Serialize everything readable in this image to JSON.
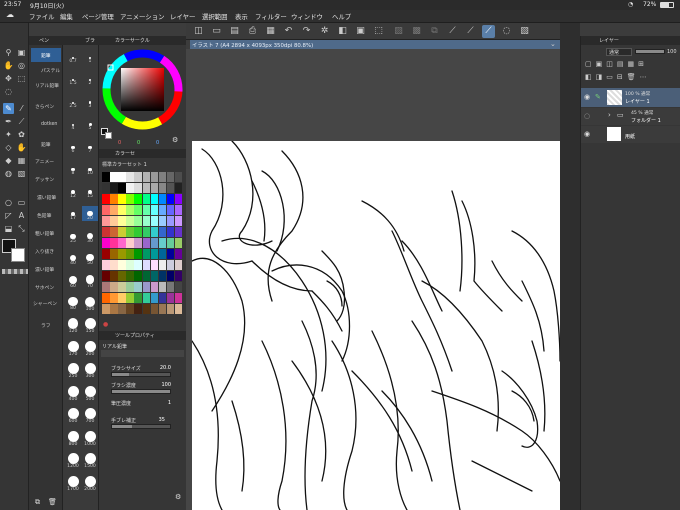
{
  "status": {
    "time": "23:57",
    "date": "9月10日(火)",
    "battery": "72%"
  },
  "menu": {
    "items": [
      "ファイル",
      "編集",
      "ページ管理",
      "アニメーション",
      "レイヤー",
      "選択範囲",
      "表示",
      "フィルター",
      "ウィンドウ",
      "ヘルプ"
    ]
  },
  "document": {
    "tab_title": "イラスト 7 (A4 2894 x 4093px 350dpi 80.8%)"
  },
  "subtool": {
    "tab": "ペン",
    "items": [
      "鉛筆",
      "パステル",
      "リアル鉛筆",
      "さらペン",
      "dotken",
      "鉛筆",
      "アニメー",
      "デッサン",
      "濃い鉛筆",
      "色鉛筆",
      "粗い鉛筆",
      "入り抜き",
      "濃い鉛筆",
      "サホペン",
      "シャーペン",
      "ラフ"
    ]
  },
  "brush_sizes": {
    "tab": "ブラ",
    "values": [
      "0.7",
      "1",
      "1.5",
      "2",
      "2.5",
      "3",
      "4",
      "5",
      "6",
      "7",
      "8",
      "10",
      "12",
      "15",
      "17",
      "20",
      "25",
      "30",
      "40",
      "50",
      "60",
      "70",
      "80",
      "100",
      "120",
      "150",
      "170",
      "200",
      "250",
      "300",
      "400",
      "500",
      "600",
      "700",
      "800",
      "1000",
      "1200",
      "1500",
      "1700",
      "2000"
    ]
  },
  "color_wheel": {
    "title": "カラーサークル",
    "h": "0",
    "s": "0",
    "v": "0"
  },
  "color_set": {
    "title": "カラーセ",
    "set_name": "標準カラーセット 1"
  },
  "tool_property": {
    "title": "ツールプロパティ",
    "tool_name": "リアル鉛筆",
    "brush_size_label": "ブラシサイズ",
    "brush_size": "20.0",
    "brush_density_label": "ブラシ濃度",
    "brush_density": "100",
    "ink_label": "筆圧濃度",
    "ink": "1",
    "stabilization_label": "手ブレ補正",
    "stabilization": "35"
  },
  "layer": {
    "title": "レイヤー",
    "blend_mode": "通常",
    "opacity": "100",
    "layers": [
      {
        "meta": "100 % 通常",
        "name": "レイヤー 1"
      },
      {
        "meta": "45 % 通常",
        "name": "フォルダー 1"
      },
      {
        "meta": "",
        "name": "用紙"
      }
    ]
  },
  "colors": {
    "accent": "#4d8bd0",
    "menubar": "#2f2f2f",
    "panel": "#363636",
    "paper": "#ffffff"
  }
}
